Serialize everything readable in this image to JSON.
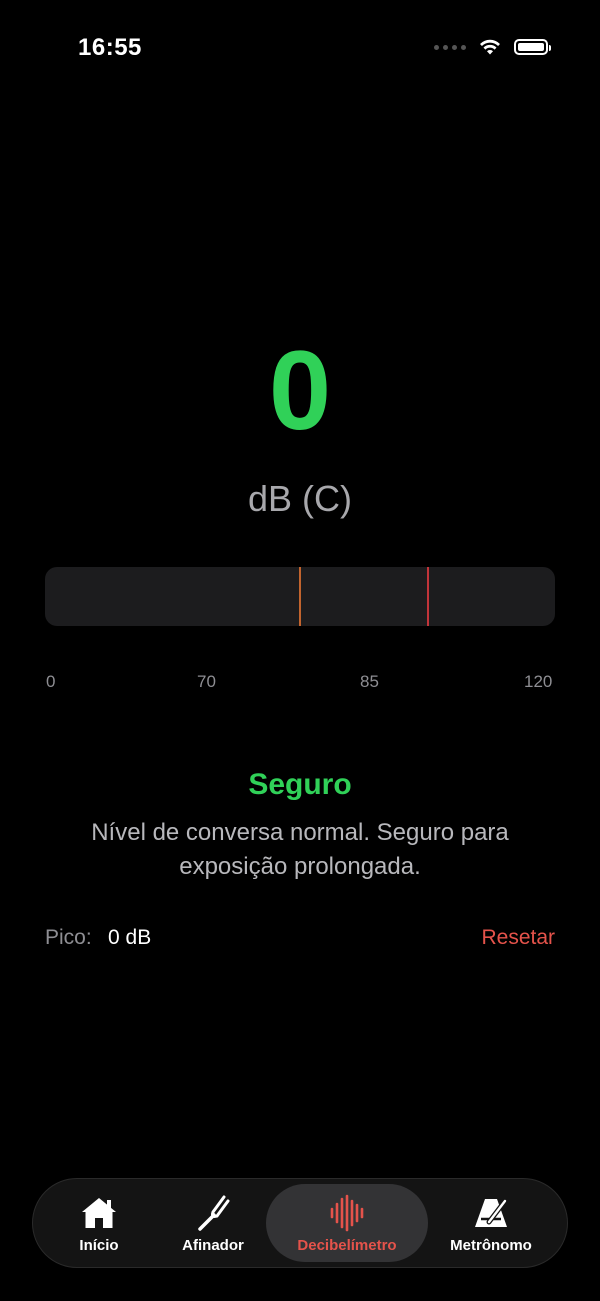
{
  "status_bar": {
    "time": "16:55"
  },
  "meter": {
    "reading": "0",
    "unit": "dB (C)",
    "level_fraction": 0.0,
    "scale_labels": [
      "0",
      "70",
      "85",
      "120"
    ],
    "marker_colors": {
      "warning": "#c2642e",
      "danger": "#c2343a"
    }
  },
  "status": {
    "label": "Seguro",
    "description": "Nível de conversa normal. Seguro para exposição prolongada.",
    "color": "#30d158"
  },
  "peak": {
    "label": "Pico:",
    "value": "0 dB",
    "reset_label": "Resetar"
  },
  "tabs": [
    {
      "label": "Início",
      "icon": "home-icon",
      "active": false
    },
    {
      "label": "Afinador",
      "icon": "tuning-fork-icon",
      "active": false
    },
    {
      "label": "Decibelímetro",
      "icon": "waveform-icon",
      "active": true
    },
    {
      "label": "Metrônomo",
      "icon": "metronome-icon",
      "active": false
    }
  ],
  "colors": {
    "accent_green": "#30d158",
    "accent_red": "#e5534b",
    "background": "#000000"
  }
}
